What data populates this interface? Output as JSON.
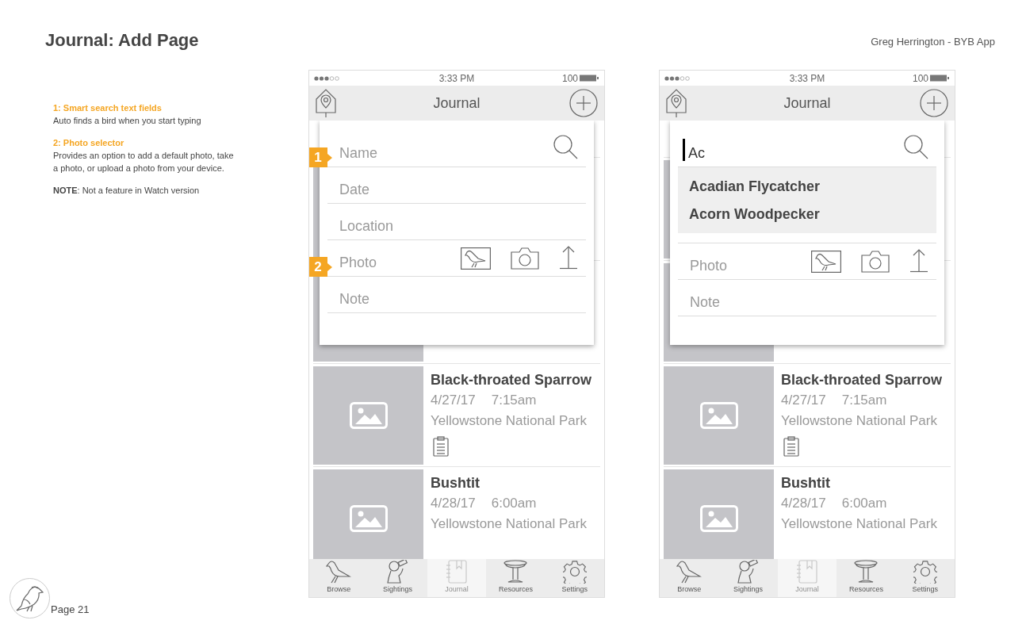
{
  "header": {
    "title": "Journal: Add Page",
    "author": "Greg Herrington - BYB App"
  },
  "notes": [
    {
      "title": "1: Smart search text fields",
      "body": "Auto finds a bird when you start typing"
    },
    {
      "title": "2: Photo selector",
      "body": "Provides an option to add a default photo, take a photo, or upload a photo from your device."
    }
  ],
  "remark": "**NOTE**: Not a feature in Watch version",
  "screens": [
    {
      "status_bar": {
        "time": "3:33 PM",
        "battery": "100"
      },
      "nav_title": "Journal",
      "form": [
        {
          "kind": "search",
          "placeholder": "Name",
          "marker": "1"
        },
        {
          "kind": "text",
          "placeholder": "Date"
        },
        {
          "kind": "text",
          "placeholder": "Location"
        },
        {
          "kind": "photo",
          "placeholder": "Photo",
          "marker": "2"
        },
        {
          "kind": "text",
          "placeholder": "Note"
        }
      ],
      "entries": [
        {
          "name": "Black-throated Sparrow",
          "date": "4/27/17",
          "time": "7:15am",
          "location": "Yellowstone National Park",
          "has_note": true
        },
        {
          "name": "Bushtit",
          "date": "4/28/17",
          "time": "6:00am",
          "location": "Yellowstone National Park",
          "has_note": false
        }
      ],
      "tabs": [
        {
          "label": "Browse",
          "selected": false
        },
        {
          "label": "Sightings",
          "selected": false
        },
        {
          "label": "Journal",
          "selected": true
        },
        {
          "label": "Resources",
          "selected": false
        },
        {
          "label": "Settings",
          "selected": false
        }
      ]
    },
    {
      "status_bar": {
        "time": "3:33 PM",
        "battery": "100"
      },
      "nav_title": "Journal",
      "form": [
        {
          "kind": "search",
          "value": "Ac",
          "focused": true
        },
        {
          "kind": "suggestions",
          "items": [
            "Acadian Flycatcher",
            "Acorn Woodpecker"
          ]
        },
        {
          "kind": "photo",
          "placeholder": "Photo"
        },
        {
          "kind": "text",
          "placeholder": "Note"
        }
      ],
      "entries": [
        {
          "name": "Black-throated Sparrow",
          "date": "4/27/17",
          "time": "7:15am",
          "location": "Yellowstone National Park",
          "has_note": true
        },
        {
          "name": "Bushtit",
          "date": "4/28/17",
          "time": "6:00am",
          "location": "Yellowstone National Park",
          "has_note": false
        }
      ],
      "tabs": [
        {
          "label": "Browse",
          "selected": false
        },
        {
          "label": "Sightings",
          "selected": false
        },
        {
          "label": "Journal",
          "selected": true
        },
        {
          "label": "Resources",
          "selected": false
        },
        {
          "label": "Settings",
          "selected": false
        }
      ]
    }
  ],
  "footer": {
    "page": "Page 21"
  }
}
